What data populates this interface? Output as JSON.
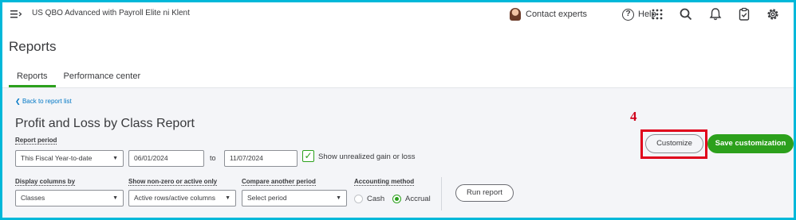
{
  "header": {
    "company_name": "US QBO Advanced with Payroll Elite ni Klent",
    "contact_label": "Contact experts",
    "help_label": "Help",
    "icons": [
      "hamburger-icon",
      "apps-icon",
      "search-icon",
      "bell-icon",
      "task-icon",
      "gear-icon"
    ]
  },
  "page": {
    "title": "Reports",
    "tabs": [
      {
        "label": "Reports",
        "active": true
      },
      {
        "label": "Performance center",
        "active": false
      }
    ]
  },
  "report": {
    "back_link": "Back to report list",
    "title": "Profit and Loss by Class Report",
    "report_period_label": "Report period",
    "report_period_value": "This Fiscal Year-to-date",
    "start_date": "06/01/2024",
    "to_label": "to",
    "end_date": "11/07/2024",
    "unrealized_label": "Show unrealized gain or loss",
    "unrealized_checked": true,
    "display_columns_label": "Display columns by",
    "display_columns_value": "Classes",
    "show_nonzero_label": "Show non-zero or active only",
    "show_nonzero_value": "Active rows/active columns",
    "compare_label": "Compare another period",
    "compare_placeholder": "Select period",
    "accounting_method_label": "Accounting method",
    "method_cash": "Cash",
    "method_accrual": "Accrual",
    "method_selected": "Accrual",
    "run_report_label": "Run report",
    "customize_label": "Customize",
    "save_customization_label": "Save customization"
  },
  "annotation": {
    "step_number": "4",
    "color": "#e0001b"
  },
  "colors": {
    "accent_green": "#2ca01c",
    "link_blue": "#0077c5",
    "border_cyan": "#00b8d9"
  }
}
